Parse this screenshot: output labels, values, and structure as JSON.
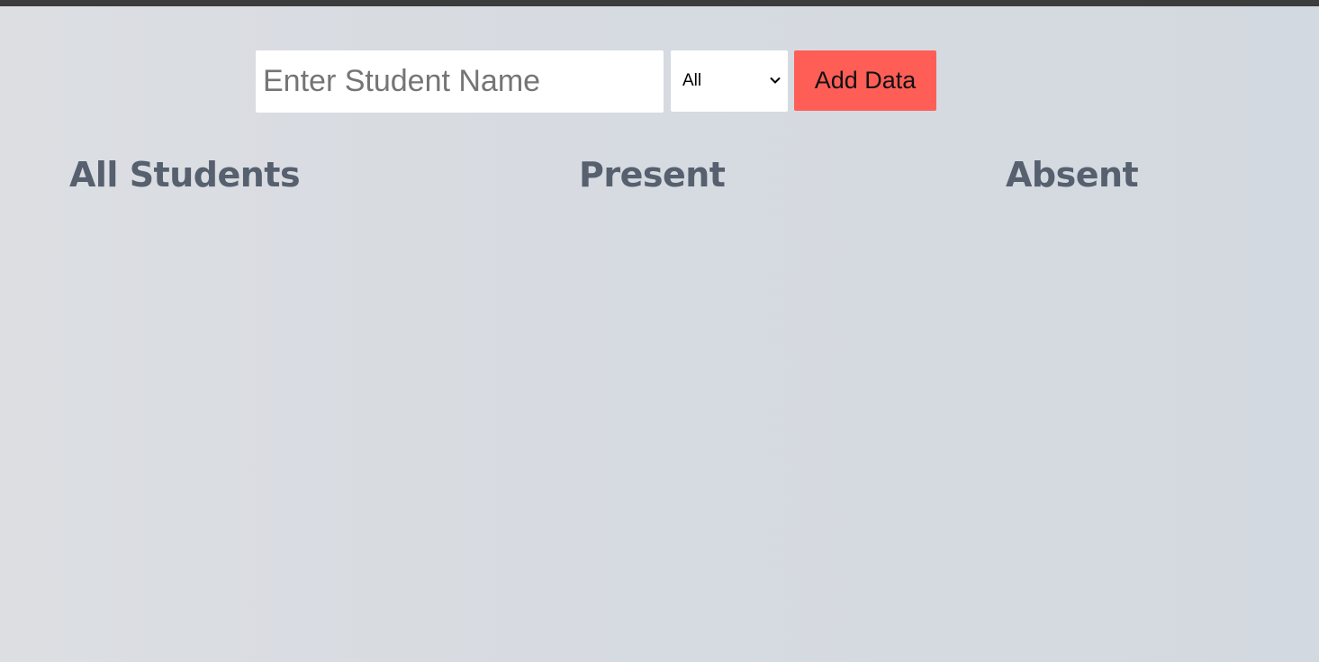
{
  "form": {
    "name_input": {
      "placeholder": "Enter Student Name",
      "value": ""
    },
    "status_select": {
      "selected": "All"
    },
    "add_button_label": "Add Data"
  },
  "columns": {
    "all_students": "All Students",
    "present": "Present",
    "absent": "Absent"
  },
  "colors": {
    "add_button": "#ff5e57",
    "heading": "#56606e",
    "top_bar": "#3c3c3c"
  }
}
